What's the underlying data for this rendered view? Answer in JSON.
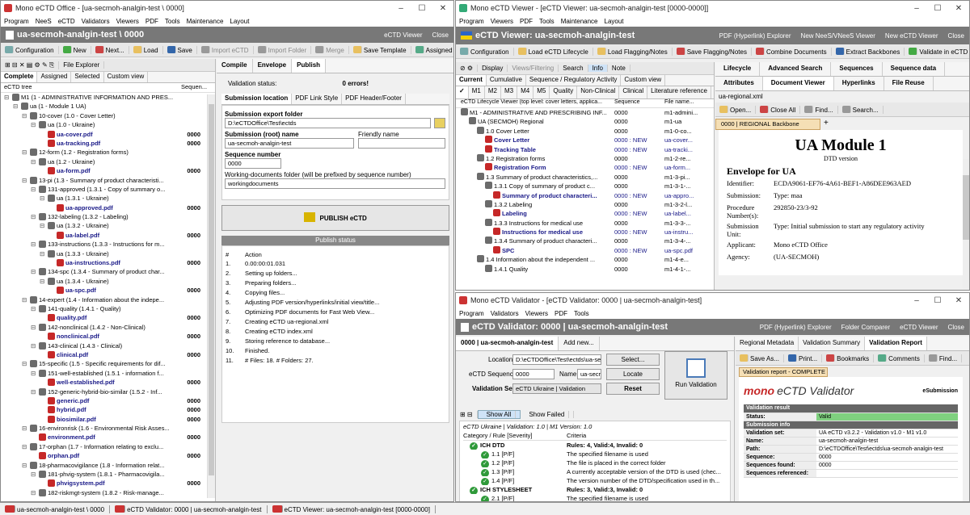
{
  "office": {
    "title": "Mono eCTD Office - [ua-secmoh-analgin-test \\ 0000]",
    "menu": [
      "Program",
      "NeeS",
      "eCTD",
      "Validators",
      "Viewers",
      "PDF",
      "Tools",
      "Maintenance",
      "Layout"
    ],
    "header": "ua-secmoh-analgin-test \\ 0000",
    "header_right": [
      "eCTD Viewer",
      "Close"
    ],
    "toolbar": [
      "Configuration",
      "New",
      "Next...",
      "Load",
      "Save",
      "Import eCTD",
      "Import Folder",
      "Merge",
      "Save Template",
      "Assigned Report"
    ],
    "tree_toolbar": "File Explorer",
    "tree_tabs": [
      "Complete",
      "Assigned",
      "Selected",
      "Custom view"
    ],
    "tree_header": {
      "col1": "eCTD tree",
      "col2": "Sequen..."
    },
    "tree": [
      {
        "text": "M1 (1 - ADMINISTRATIVE INFORMATION AND PRES...",
        "l": 0,
        "f": 0,
        "s": ""
      },
      {
        "text": "ua (1 - Module 1 UA)",
        "l": 1,
        "f": 0,
        "s": ""
      },
      {
        "text": "10-cover (1.0 - Cover Letter)",
        "l": 2,
        "f": 0,
        "s": ""
      },
      {
        "text": "ua (1.0 - Ukraine)",
        "l": 3,
        "f": 0,
        "s": ""
      },
      {
        "text": "ua-cover.pdf",
        "l": 4,
        "f": 1,
        "s": "0000"
      },
      {
        "text": "ua-tracking.pdf",
        "l": 4,
        "f": 1,
        "s": "0000"
      },
      {
        "text": "12-form (1.2 - Registration forms)",
        "l": 2,
        "f": 0,
        "s": ""
      },
      {
        "text": "ua (1.2 - Ukraine)",
        "l": 3,
        "f": 0,
        "s": ""
      },
      {
        "text": "ua-form.pdf",
        "l": 4,
        "f": 1,
        "s": "0000"
      },
      {
        "text": "13-pi (1.3 - Summary of product characteristi...",
        "l": 2,
        "f": 0,
        "s": ""
      },
      {
        "text": "131-approved (1.3.1 - Copy of summary o...",
        "l": 3,
        "f": 0,
        "s": ""
      },
      {
        "text": "ua (1.3.1 - Ukraine)",
        "l": 4,
        "f": 0,
        "s": ""
      },
      {
        "text": "ua-approved.pdf",
        "l": 5,
        "f": 1,
        "s": "0000"
      },
      {
        "text": "132-labeling (1.3.2 - Labeling)",
        "l": 3,
        "f": 0,
        "s": ""
      },
      {
        "text": "ua (1.3.2 - Ukraine)",
        "l": 4,
        "f": 0,
        "s": ""
      },
      {
        "text": "ua-label.pdf",
        "l": 5,
        "f": 1,
        "s": "0000"
      },
      {
        "text": "133-instructions (1.3.3 - Instructions for m...",
        "l": 3,
        "f": 0,
        "s": ""
      },
      {
        "text": "ua (1.3.3 - Ukraine)",
        "l": 4,
        "f": 0,
        "s": ""
      },
      {
        "text": "ua-instructions.pdf",
        "l": 5,
        "f": 1,
        "s": "0000"
      },
      {
        "text": "134-spc (1.3.4 - Summary of product char...",
        "l": 3,
        "f": 0,
        "s": ""
      },
      {
        "text": "ua (1.3.4 - Ukraine)",
        "l": 4,
        "f": 0,
        "s": ""
      },
      {
        "text": "ua-spc.pdf",
        "l": 5,
        "f": 1,
        "s": "0000"
      },
      {
        "text": "14-expert (1.4 - Information about the indepe...",
        "l": 2,
        "f": 0,
        "s": ""
      },
      {
        "text": "141-quality (1.4.1 - Quality)",
        "l": 3,
        "f": 0,
        "s": ""
      },
      {
        "text": "quality.pdf",
        "l": 4,
        "f": 1,
        "s": "0000"
      },
      {
        "text": "142-nonclinical (1.4.2 - Non-Clinical)",
        "l": 3,
        "f": 0,
        "s": ""
      },
      {
        "text": "nonclinical.pdf",
        "l": 4,
        "f": 1,
        "s": "0000"
      },
      {
        "text": "143-clinical (1.4.3 - Clinical)",
        "l": 3,
        "f": 0,
        "s": ""
      },
      {
        "text": "clinical.pdf",
        "l": 4,
        "f": 1,
        "s": "0000"
      },
      {
        "text": "15-specific (1.5 - Specific requirements for dif...",
        "l": 2,
        "f": 0,
        "s": ""
      },
      {
        "text": "151-well-established (1.5.1 - information f...",
        "l": 3,
        "f": 0,
        "s": ""
      },
      {
        "text": "well-established.pdf",
        "l": 4,
        "f": 1,
        "s": "0000"
      },
      {
        "text": "152-generic-hybrid-bio-similar (1.5.2 - Inf...",
        "l": 3,
        "f": 0,
        "s": ""
      },
      {
        "text": "generic.pdf",
        "l": 4,
        "f": 1,
        "s": "0000"
      },
      {
        "text": "hybrid.pdf",
        "l": 4,
        "f": 1,
        "s": "0000"
      },
      {
        "text": "biosimilar.pdf",
        "l": 4,
        "f": 1,
        "s": "0000"
      },
      {
        "text": "16-environrisk (1.6 - Environmental Risk Asses...",
        "l": 2,
        "f": 0,
        "s": ""
      },
      {
        "text": "environment.pdf",
        "l": 3,
        "f": 1,
        "s": "0000"
      },
      {
        "text": "17-orphan (1.7 - Information relating to exclu...",
        "l": 2,
        "f": 0,
        "s": ""
      },
      {
        "text": "orphan.pdf",
        "l": 3,
        "f": 1,
        "s": "0000"
      },
      {
        "text": "18-pharmacovigilance (1.8 - Information relat...",
        "l": 2,
        "f": 0,
        "s": ""
      },
      {
        "text": "181-phvig-system (1.8.1 - Pharmacovigila...",
        "l": 3,
        "f": 0,
        "s": ""
      },
      {
        "text": "phvigsystem.pdf",
        "l": 4,
        "f": 1,
        "s": "0000"
      },
      {
        "text": "182-riskmgt-system (1.8.2 - Risk-manage...",
        "l": 3,
        "f": 0,
        "s": ""
      }
    ],
    "right_tabs": [
      "Compile",
      "Envelope",
      "Publish"
    ],
    "validation_label": "Validation status:",
    "validation_value": "0 errors!",
    "sub_tabs": [
      "Submission location",
      "PDF Link Style",
      "PDF Header/Footer"
    ],
    "export_folder_label": "Submission export folder",
    "export_folder": "D:\\eCTDOffice\\Test\\ectds",
    "root_name_label": "Submission (root) name",
    "root_name": "ua-secmoh-analgin-test",
    "friendly_label": "Friendly name",
    "seq_label": "Sequence number",
    "seq": "0000",
    "working_label": "Working-documents folder (will be prefixed by sequence number)",
    "working": "workingdocuments",
    "publish_btn": "PUBLISH eCTD",
    "publish_status": "Publish status",
    "log_cols": [
      "#",
      "Action"
    ],
    "log": [
      [
        "1.",
        "0.00:00:01.031"
      ],
      [
        "2.",
        "Setting up folders..."
      ],
      [
        "3.",
        "Preparing folders..."
      ],
      [
        "4.",
        "Copying files..."
      ],
      [
        "5.",
        "Adjusting PDF version/hyperlinks/initial view/title..."
      ],
      [
        "6.",
        "Optimizing PDF documents for Fast Web View..."
      ],
      [
        "7.",
        "Creating eCTD ua-regional.xml"
      ],
      [
        "8.",
        "Creating eCTD index.xml"
      ],
      [
        "9.",
        "Storing reference to database..."
      ],
      [
        "10.",
        "Finished."
      ],
      [
        "11.",
        "# Files: 18. # Folders: 27."
      ]
    ]
  },
  "viewer": {
    "title": "Mono eCTD Viewer - [eCTD Viewer: ua-secmoh-analgin-test [0000-0000]]",
    "menu": [
      "Program",
      "Viewers",
      "PDF",
      "Tools",
      "Maintenance",
      "Layout"
    ],
    "header": "eCTD Viewer: ua-secmoh-analgin-test [0000-0000]",
    "header_right": [
      "PDF (Hyperlink) Explorer",
      "New NeeS/VNeeS Viewer",
      "New eCTD Viewer",
      "Close"
    ],
    "toolbar": [
      "Configuration",
      "Load eCTD Lifecycle",
      "Load Flagging/Notes",
      "Save Flagging/Notes",
      "Combine Documents",
      "Extract Backbones",
      "Validate in eCTD Valida"
    ],
    "toolbar2": [
      "Display",
      "Views/Filtering",
      "Search",
      "Info",
      "Note"
    ],
    "tabs": [
      "Current",
      "Cumulative",
      "Sequence / Regulatory Activity",
      "Custom view"
    ],
    "mod_tabs": [
      "M1",
      "M2",
      "M3",
      "M4",
      "M5",
      "Quality",
      "Non-Clinical",
      "Clinical",
      "Literature reference"
    ],
    "cols": [
      "eCTD Lifecycle Viewer  (top level: cover letters, applica...",
      "Sequence",
      "File name..."
    ],
    "rows": [
      [
        "M1 - ADMINISTRATIVE AND PRESCRIBING INF...",
        "0000",
        "m1-admini...",
        0,
        0
      ],
      [
        "UA (SECMOH) Regional",
        "0000",
        "m1-ua",
        1,
        0
      ],
      [
        "1.0 Cover Letter",
        "0000",
        "m1-0-co...",
        2,
        0
      ],
      [
        "Cover Letter",
        "0000 : NEW",
        "ua-cover...",
        3,
        1
      ],
      [
        "Tracking Table",
        "0000 : NEW",
        "ua-tracki...",
        3,
        1
      ],
      [
        "1.2 Registration forms",
        "0000",
        "m1-2-re...",
        2,
        0
      ],
      [
        "Registration Form",
        "0000 : NEW",
        "ua-form...",
        3,
        1
      ],
      [
        "1.3 Summary of product characteristics,...",
        "0000",
        "m1-3-pi...",
        2,
        0
      ],
      [
        "1.3.1 Copy of summary of product c...",
        "0000",
        "m1-3-1-...",
        3,
        0
      ],
      [
        "Summary of product characteri...",
        "0000 : NEW",
        "ua-appro...",
        4,
        1
      ],
      [
        "1.3.2 Labeling",
        "0000",
        "m1-3-2-l...",
        3,
        0
      ],
      [
        "Labeling",
        "0000 : NEW",
        "ua-label...",
        4,
        1
      ],
      [
        "1.3.3 Instructions for medical use",
        "0000",
        "m1-3-3-...",
        3,
        0
      ],
      [
        "Instructions for medical use",
        "0000 : NEW",
        "ua-instru...",
        4,
        1
      ],
      [
        "1.3.4 Summary of product characteri...",
        "0000",
        "m1-3-4-...",
        3,
        0
      ],
      [
        "SPC",
        "0000 : NEW",
        "ua-spc.pdf",
        4,
        1
      ],
      [
        "1.4 Information about the independent ...",
        "0000",
        "m1-4-e...",
        2,
        0
      ],
      [
        "1.4.1 Quality",
        "0000",
        "m1-4-1-...",
        3,
        0
      ]
    ],
    "right_tabs1": [
      "Lifecycle",
      "Advanced Search",
      "Sequences",
      "Sequence data"
    ],
    "right_tabs2": [
      "Attributes",
      "Document Viewer",
      "Hyperlinks",
      "File Reuse"
    ],
    "file": "ua-regional.xml",
    "doc_toolbar": [
      "Open...",
      "Close All",
      "Find...",
      "Search..."
    ],
    "doc_tab": "0000 | REGIONAL Backbone",
    "doc_title": "UA Module 1",
    "doc_sub": "DTD version",
    "env_title": "Envelope for UA",
    "fields": [
      [
        "Identifier:",
        "ECDA9061-EF76-4A61-BEF1-A86DEE963AED"
      ],
      [
        "Submission:",
        "Type: maa"
      ],
      [
        "Procedure Number(s):",
        "292850-23/3-92"
      ],
      [
        "Submission Unit:",
        "Type: Initial submission to start any regulatory activity"
      ],
      [
        "Applicant:",
        "Mono eCTD Office"
      ],
      [
        "Agency:",
        "(UA-SECMOH)"
      ]
    ]
  },
  "validator": {
    "title": "Mono eCTD Validator - [eCTD Validator: 0000 | ua-secmoh-analgin-test]",
    "menu": [
      "Program",
      "Validators",
      "Viewers",
      "PDF",
      "Tools"
    ],
    "header": "eCTD Validator: 0000 | ua-secmoh-analgin-test",
    "header_right": [
      "PDF (Hyperlink) Explorer",
      "Folder Comparer",
      "eCTD Viewer",
      "Close"
    ],
    "tabs": [
      "0000 | ua-secmoh-analgin-test",
      "Add new..."
    ],
    "location_label": "Location",
    "location": "D:\\eCTDOffice\\Test\\ectds\\ua-se",
    "select_btn": "Select...",
    "seq_label": "eCTD Sequence",
    "seq": "0000",
    "name_label": "Name",
    "name": "ua-secr",
    "locate_btn": "Locate",
    "vset_label": "Validation Set",
    "vset": "eCTD Ukraine | Validation",
    "reset_btn": "Reset",
    "run_btn": "Run Validation",
    "show_all": "Show All",
    "show_failed": "Show Failed",
    "info": "eCTD Ukraine | Validation: 1.0 | M1 Version: 1.0",
    "cols": [
      "Category / Rule [Severity]",
      "Criteria"
    ],
    "rules": [
      [
        "ICH DTD",
        "Rules: 4, Valid:4, Invalid: 0",
        0
      ],
      [
        "1.1 [P/F]",
        "The specified filename is used",
        1
      ],
      [
        "1.2 [P/F]",
        "The file is placed in the correct folder",
        1
      ],
      [
        "1.3 [P/F]",
        "A currently acceptable version of the DTD is used (chec...",
        1
      ],
      [
        "1.4 [P/F]",
        "The version number of the DTD/specification used in th...",
        1
      ],
      [
        "ICH STYLESHEET",
        "Rules: 3, Valid:3, Invalid: 0",
        0
      ],
      [
        "2.1 [P/F]",
        "The specified filename is used",
        1
      ]
    ],
    "right_tabs": [
      "Regional Metadata",
      "Validation Summary",
      "Validation Report"
    ],
    "report_toolbar": [
      "Save As...",
      "Print...",
      "Bookmarks",
      "Comments",
      "Find..."
    ],
    "report_tab": "Validation report - COMPLETE",
    "report_logo": "mono",
    "report_logo2": "eCTD Validator",
    "report_esub": "eSubmission",
    "report_rows": [
      [
        "Validation result",
        "",
        1
      ],
      [
        "Status:",
        "Valid",
        0
      ],
      [
        "Submission info",
        "",
        1
      ],
      [
        "Validation set:",
        "UA eCTD v3.2.2 - Validation v1.0 - M1 v1.0",
        0
      ],
      [
        "Name:",
        "ua-secmoh-analgin-test",
        0
      ],
      [
        "Path:",
        "D:\\eCTDOffice\\Test\\ectds\\ua-secmoh-analgin-test",
        0
      ],
      [
        "Sequence:",
        "0000",
        0
      ],
      [
        "Sequences found:",
        "0000",
        0
      ],
      [
        "Sequences referenced:",
        "",
        0
      ]
    ]
  },
  "statusbar": [
    "ua-secmoh-analgin-test \\ 0000",
    "eCTD Validator: 0000 | ua-secmoh-analgin-test",
    "eCTD Viewer: ua-secmoh-analgin-test [0000-0000]"
  ],
  "colors": {
    "header": "#787878",
    "folder": "#6b6b6b",
    "pdf": "#c62828",
    "valid": "#7fd17f",
    "accent": "#f0c000"
  }
}
